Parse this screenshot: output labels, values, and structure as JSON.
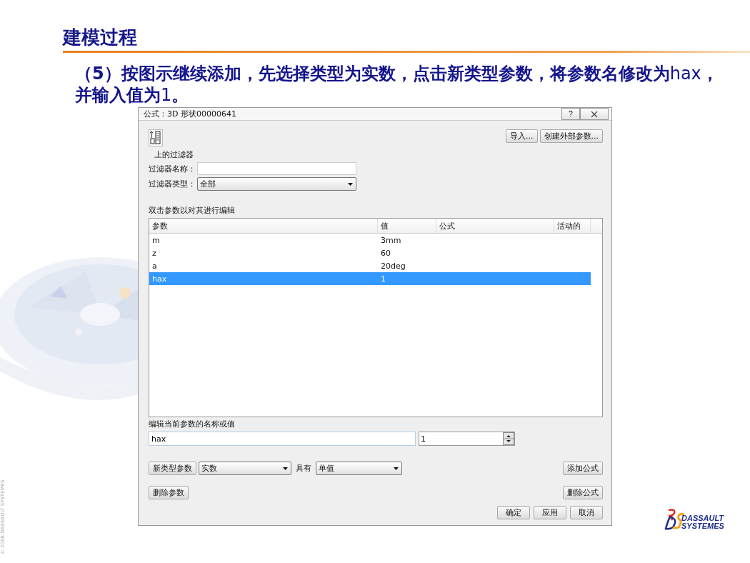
{
  "slide": {
    "title": "建模过程",
    "instruction": "**（5）按图示继续添加，先选择类型为实数，点击新类型参数，将参数名修改为**hax**，并输入值为**1**。**",
    "copyright": "© 2008 DASSAULT SYSTEMES",
    "logo_text": [
      "DASSAULT",
      "SYSTEMES"
    ]
  },
  "dialog": {
    "title": "公式：3D 形状00000641",
    "help": "?",
    "buttons_top": [
      "导入...",
      "创建外部参数..."
    ],
    "filter": {
      "heading": "上的过滤器",
      "name_label": "过滤器名称：",
      "type_label": "过滤器类型：",
      "type_value": "全部"
    },
    "table_hint": "双击参数以对其进行编辑",
    "columns": [
      "参数",
      "值",
      "公式",
      "活动的"
    ],
    "rows": [
      {
        "cells": [
          "m",
          "3mm"
        ],
        "selected": false
      },
      {
        "cells": [
          "z",
          "60"
        ],
        "selected": false
      },
      {
        "cells": [
          "a",
          "20deg"
        ],
        "selected": false
      },
      {
        "cells": [
          "hax",
          "1"
        ],
        "selected": true
      }
    ],
    "edit_label": "编辑当前参数的名称或值",
    "name_value": "hax",
    "value_value": "1",
    "new_type_button": "新类型参数",
    "type_value": "实数",
    "with_label": "具有",
    "multiplicity_value": "单值",
    "add_formula": "添加公式",
    "delete_param": "删除参数",
    "delete_formula": "删除公式",
    "footer_buttons": [
      "确定",
      "应用",
      "取消"
    ]
  }
}
